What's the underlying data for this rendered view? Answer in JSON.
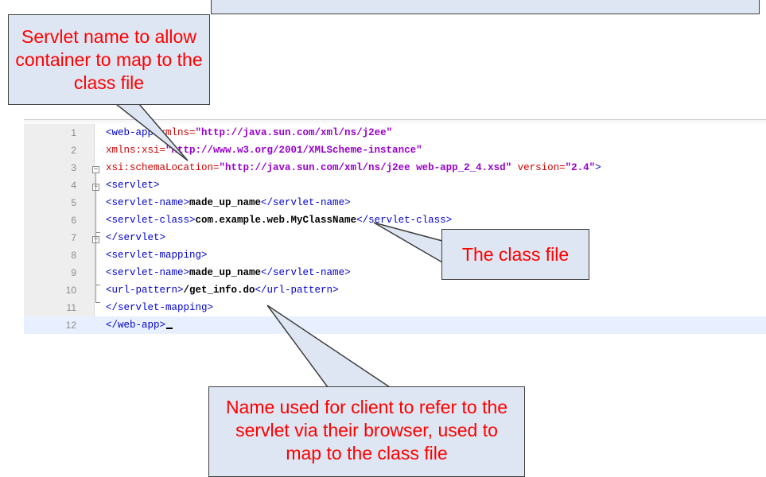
{
  "editor": {
    "lines": [
      {
        "num": "1",
        "segments": [
          [
            "tag",
            "<web-app "
          ],
          [
            "attr",
            "xmlns="
          ],
          [
            "val",
            "\"http://java.sun.com/xml/ns/j2ee\""
          ]
        ]
      },
      {
        "num": "2",
        "segments": [
          [
            "attr",
            "xmlns:xsi="
          ],
          [
            "val",
            "\"http://www.w3.org/2001/XMLScheme-instance\""
          ]
        ]
      },
      {
        "num": "3",
        "segments": [
          [
            "attr",
            "xsi:schemaLocation="
          ],
          [
            "val",
            "\"http://java.sun.com/xml/ns/j2ee web-app_2_4.xsd\""
          ],
          [
            "tag",
            " "
          ],
          [
            "attr",
            "version="
          ],
          [
            "val",
            "\"2.4\""
          ],
          [
            "tag",
            ">"
          ]
        ]
      },
      {
        "num": "4",
        "segments": [
          [
            "tag",
            "<servlet>"
          ]
        ]
      },
      {
        "num": "5",
        "segments": [
          [
            "tag",
            "<servlet-name>"
          ],
          [
            "txt",
            "made_up_name"
          ],
          [
            "tag",
            "</servlet-name>"
          ]
        ]
      },
      {
        "num": "6",
        "segments": [
          [
            "tag",
            "<servlet-class>"
          ],
          [
            "txt",
            "com.example.web.MyClassName"
          ],
          [
            "tag",
            "</servlet-class>"
          ]
        ]
      },
      {
        "num": "7",
        "segments": [
          [
            "tag",
            "</servlet>"
          ]
        ]
      },
      {
        "num": "8",
        "segments": [
          [
            "tag",
            "<servlet-mapping>"
          ]
        ]
      },
      {
        "num": "9",
        "segments": [
          [
            "tag",
            "<servlet-name>"
          ],
          [
            "txt",
            "made_up_name"
          ],
          [
            "tag",
            "</servlet-name>"
          ]
        ]
      },
      {
        "num": "10",
        "segments": [
          [
            "tag",
            "<url-pattern>"
          ],
          [
            "txt",
            "/get_info.do"
          ],
          [
            "tag",
            "</url-pattern>"
          ]
        ]
      },
      {
        "num": "11",
        "segments": [
          [
            "tag",
            "</servlet-mapping>"
          ]
        ]
      },
      {
        "num": "12",
        "segments": [
          [
            "tag",
            "</web-app>"
          ]
        ]
      }
    ]
  },
  "callouts": {
    "servlet_name": "Servlet name to allow container to map to the class file",
    "class_file": "The class file",
    "url_pattern": "Name used for client to refer to the servlet via their browser, used to map to the class file"
  },
  "colors": {
    "callout_fill": "#dde6f2",
    "callout_text": "#ff0000",
    "xml_tag": "#0000cc",
    "xml_attribute": "#cc0000",
    "xml_value": "#9900cc"
  }
}
